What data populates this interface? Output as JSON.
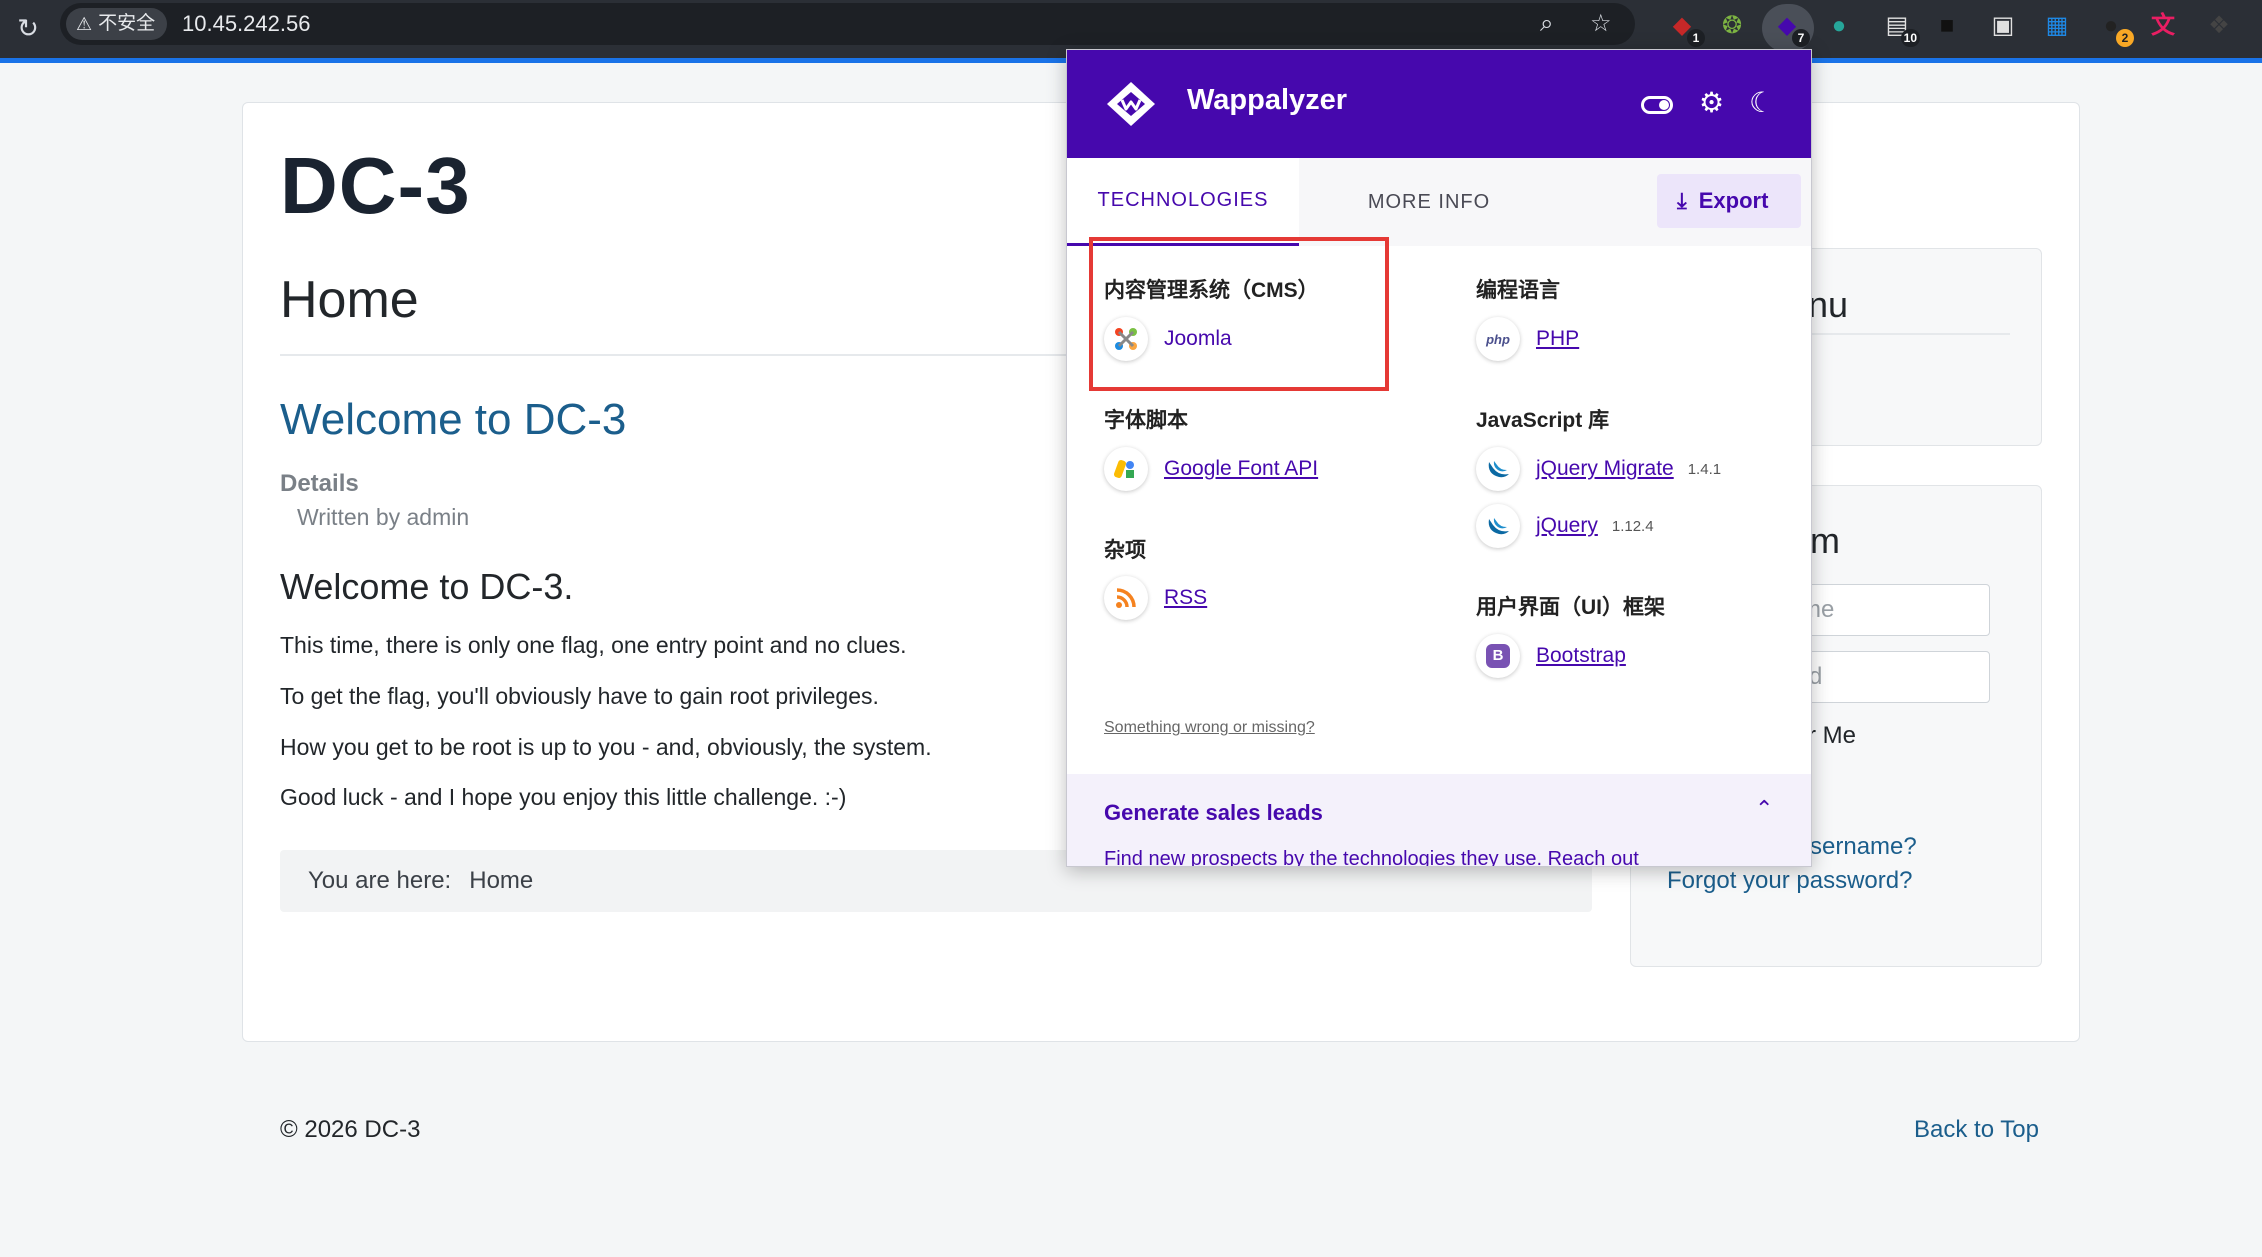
{
  "browser": {
    "security_label": "不安全",
    "url": "10.45.242.56",
    "extensions": [
      {
        "name": "shield-extension",
        "badge": "1",
        "color": "#c62828"
      },
      {
        "name": "green-extension",
        "badge": "",
        "color": "#7cb342"
      },
      {
        "name": "wappalyzer-extension",
        "badge": "7",
        "color": "#4608ad"
      },
      {
        "name": "globe-extension",
        "badge": "",
        "color": "#26a69a"
      },
      {
        "name": "save-extension",
        "badge": "10",
        "color": "#e0e0e0"
      },
      {
        "name": "dark-extension",
        "badge": "",
        "color": "#111111"
      },
      {
        "name": "camera-extension",
        "badge": "",
        "color": "#e0e0e0"
      },
      {
        "name": "window-extension",
        "badge": "",
        "color": "#1e88e5"
      },
      {
        "name": "github-extension",
        "badge": "2",
        "color": "#222222"
      },
      {
        "name": "translate-extension",
        "badge": "",
        "color": "#e91e63"
      },
      {
        "name": "puzzle-extension",
        "badge": "",
        "color": "#444444"
      }
    ],
    "colors": {
      "toolbar": "#2b2f36",
      "loading": "#1a73e8"
    }
  },
  "page": {
    "site_title": "DC-3",
    "page_heading": "Home",
    "article_link": "Welcome to DC-3",
    "details_label": "Details",
    "written_by": "Written by admin",
    "article_heading": "Welcome to DC-3.",
    "paragraphs": [
      "This time, there is only one flag, one entry point and no clues.",
      "To get the flag, you'll obviously have to gain root privileges.",
      "How you get to be root is up to you - and, obviously, the system.",
      "Good luck - and I hope you enjoy this little challenge.  :-)"
    ],
    "breadcrumb_label": "You are here:",
    "breadcrumb_current": "Home",
    "sidebar": {
      "menu_fragment": "nu",
      "login_fragment": "m",
      "username_fragment": "me",
      "password_fragment": "rd",
      "remember_fragment": "r Me",
      "forgot_username_fragment": "sername?",
      "forgot_password": "Forgot your password?"
    },
    "footer_copyright": "© 2026 DC-3",
    "back_to_top": "Back to Top",
    "colors": {
      "link": "#1b5e8c",
      "title": "#1a2330"
    }
  },
  "wappalyzer": {
    "brand": "Wappalyzer",
    "tabs": {
      "technologies": "TECHNOLOGIES",
      "more_info": "MORE INFO"
    },
    "export_label": "Export",
    "categories": {
      "cms": {
        "label": "内容管理系统（CMS）",
        "items": [
          {
            "name": "Joomla",
            "version": ""
          }
        ]
      },
      "programming": {
        "label": "编程语言",
        "items": [
          {
            "name": "PHP",
            "version": ""
          }
        ]
      },
      "font": {
        "label": "字体脚本",
        "items": [
          {
            "name": "Google Font API",
            "version": ""
          }
        ]
      },
      "javascript": {
        "label": "JavaScript 库",
        "items": [
          {
            "name": "jQuery Migrate",
            "version": "1.4.1"
          },
          {
            "name": "jQuery",
            "version": "1.12.4"
          }
        ]
      },
      "misc": {
        "label": "杂项",
        "items": [
          {
            "name": "RSS",
            "version": ""
          }
        ]
      },
      "ui": {
        "label": "用户界面（UI）框架",
        "items": [
          {
            "name": "Bootstrap",
            "version": ""
          }
        ]
      }
    },
    "icons": {
      "php_text": "php",
      "bootstrap_text": "B"
    },
    "feedback_link": "Something wrong or missing?",
    "leads": {
      "title": "Generate sales leads",
      "subtitle": "Find new prospects by the technologies they use. Reach out"
    },
    "colors": {
      "brand": "#4608ad",
      "highlight": "#e53935"
    }
  }
}
